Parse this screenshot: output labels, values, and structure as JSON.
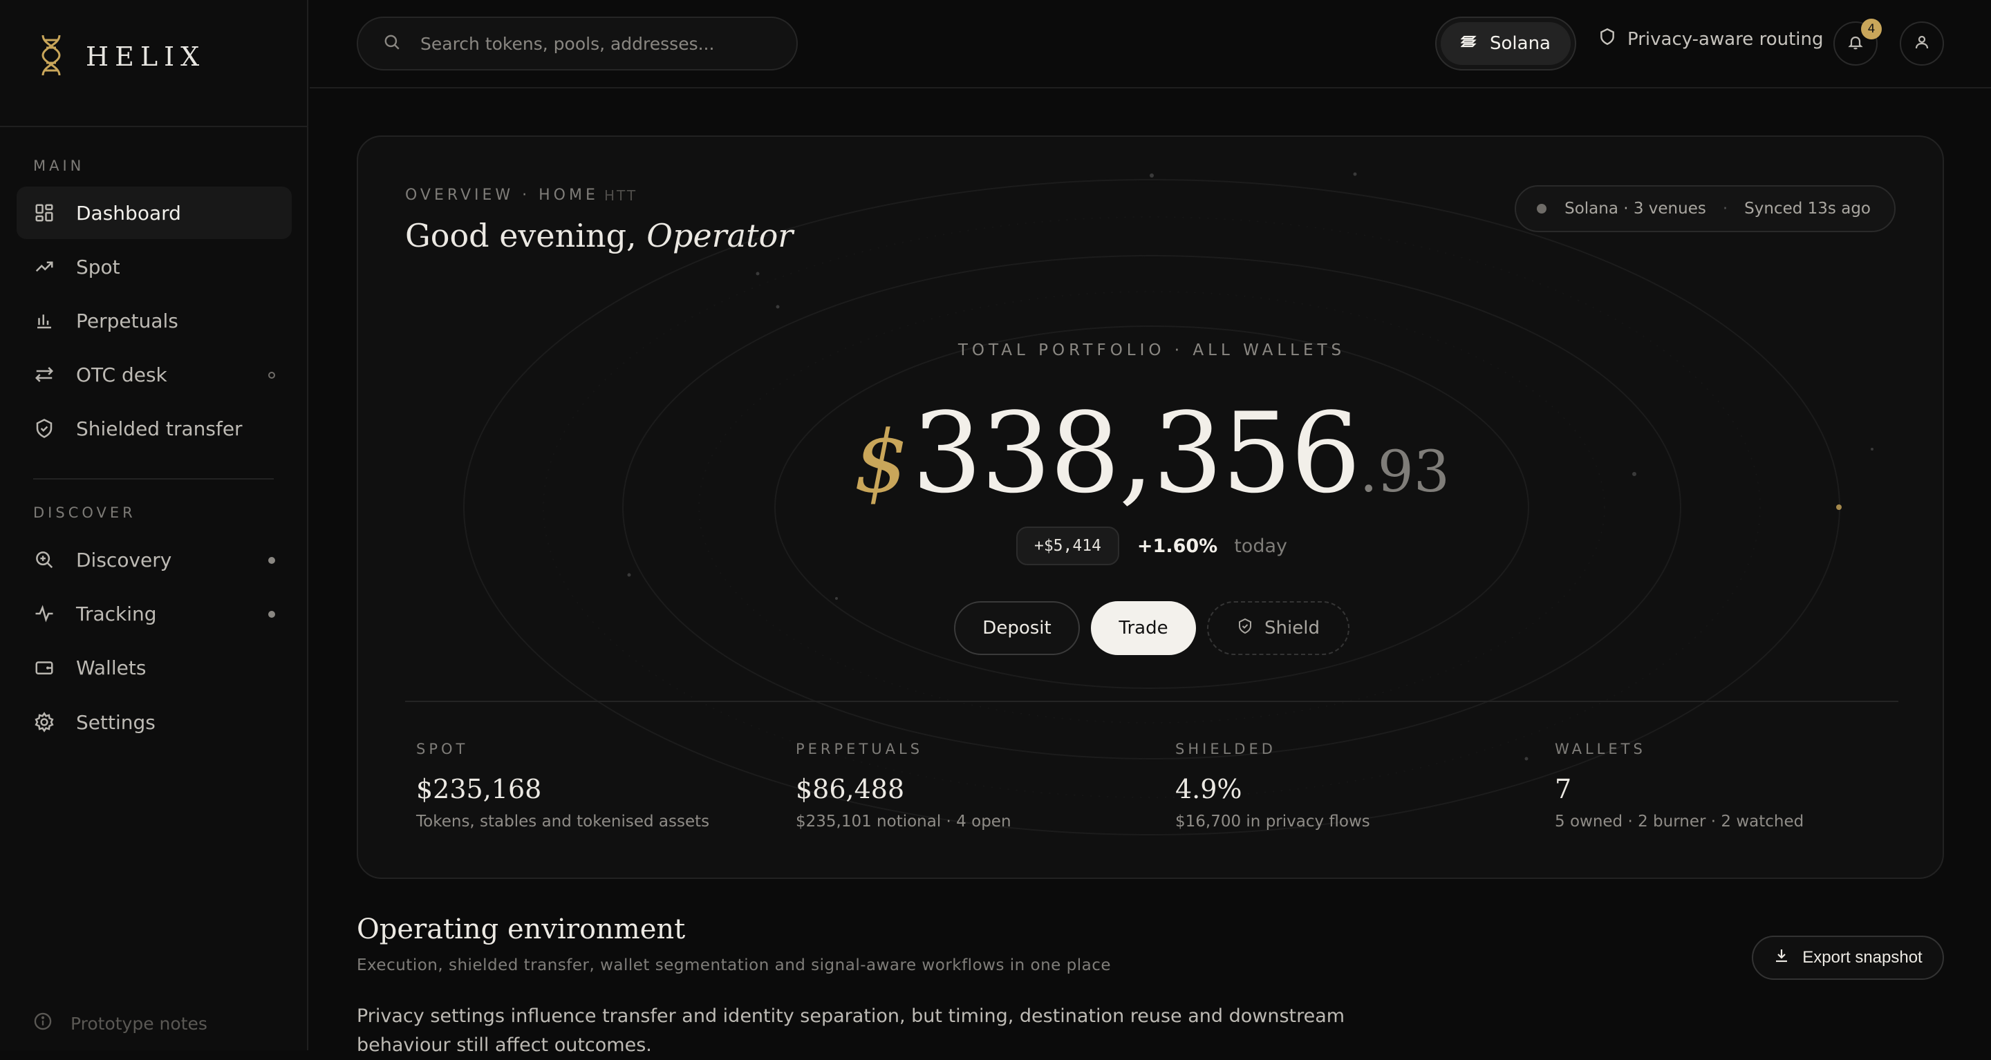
{
  "brand": {
    "name": "HELIX",
    "accent": "#c9a65a"
  },
  "sidebar": {
    "main_label": "MAIN",
    "discover_label": "DISCOVER",
    "main_items": [
      {
        "label": "Dashboard",
        "icon": "grid-icon",
        "active": true
      },
      {
        "label": "Spot",
        "icon": "trend-up-icon"
      },
      {
        "label": "Perpetuals",
        "icon": "bar-chart-icon"
      },
      {
        "label": "OTC desk",
        "icon": "swap-icon"
      },
      {
        "label": "Shielded transfer",
        "icon": "shield-check-icon"
      }
    ],
    "discover_items": [
      {
        "label": "Discovery",
        "icon": "zoom-plus-icon"
      },
      {
        "label": "Tracking",
        "icon": "pulse-icon"
      },
      {
        "label": "Wallets",
        "icon": "wallet-icon"
      },
      {
        "label": "Settings",
        "icon": "gear-icon"
      }
    ],
    "footer_label": "Prototype notes"
  },
  "topbar": {
    "search_placeholder": "Search tokens, pools, addresses...",
    "chain": "Solana",
    "privacy_label": "Privacy-aware routing",
    "notification_count": "4"
  },
  "hero": {
    "breadcrumb": "OVERVIEW · HOME",
    "breadcrumb_tag": "HTT",
    "greeting_prefix": "Good evening,",
    "greeting_name": "Operator",
    "status_network": "Solana · 3 venues",
    "status_sync": "Synced 13s ago",
    "portfolio_label": "TOTAL PORTFOLIO · ALL WALLETS",
    "currency_symbol": "$",
    "value_integer": "338,356",
    "value_decimal": ".93",
    "delta_amount": "+$5,414",
    "delta_percent": "+1.60%",
    "delta_period": "today",
    "actions": {
      "deposit": "Deposit",
      "trade": "Trade",
      "shield": "Shield"
    },
    "stats": [
      {
        "label": "SPOT",
        "value": "$235,168",
        "sub": "Tokens, stables and tokenised assets"
      },
      {
        "label": "PERPETUALS",
        "value": "$86,488",
        "sub": "$235,101 notional · 4 open"
      },
      {
        "label": "SHIELDED",
        "value": "4.9%",
        "sub": "$16,700 in privacy flows"
      },
      {
        "label": "WALLETS",
        "value": "7",
        "sub": "5 owned · 2 burner · 2 watched"
      }
    ]
  },
  "operating": {
    "title": "Operating environment",
    "subtitle": "Execution, shielded transfer, wallet segmentation and signal-aware workflows in one place",
    "export_label": "Export snapshot",
    "body": "Privacy settings influence transfer and identity separation, but timing, destination reuse and downstream behaviour still affect outcomes."
  }
}
